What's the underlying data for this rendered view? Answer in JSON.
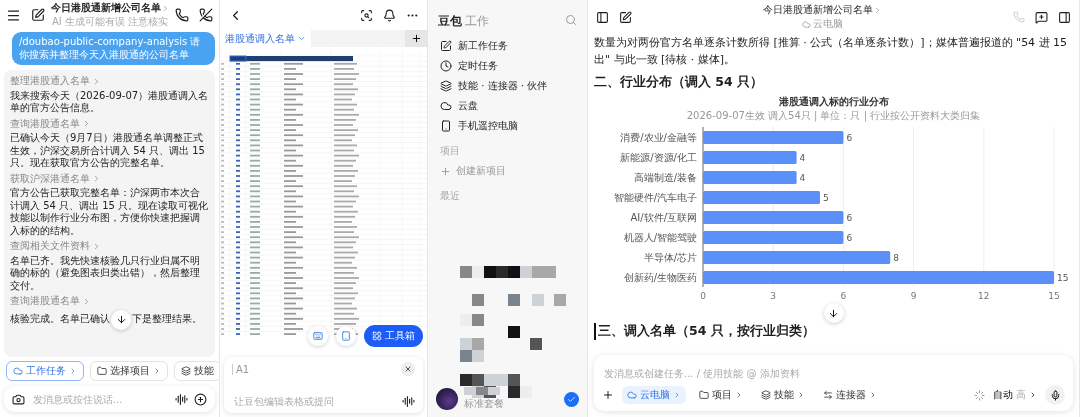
{
  "chat": {
    "title": "今日港股通新增公司名单",
    "subtitle": "AI 生成可能有误 注意核实",
    "user_message": "/doubao-public-company-analysis 请你搜索并整理今天入港股通的公司名单",
    "steps": [
      {
        "link": "整理港股通入名单",
        "text": "我来搜索今天（2026-09-07）港股通调入名单的官方公告信息。"
      },
      {
        "link": "查询港股通名单",
        "text": "已确认今天（9月7日）港股通名单调整正式生效，沪深交易所合计调入 54 只、调出 15 只。现在获取官方公告的完整名单。"
      },
      {
        "link": "获取沪深港通名单",
        "text": "官方公告已获取完整名单：沪深两市本次合计调入 54 只、调出 15 只。现在读取可视化技能以制作行业分布图，方便你快速把握调入标的的结构。"
      },
      {
        "link": "查阅相关文件资料",
        "text": "名单已齐。我先快速核验几只行业归属不明确的标的（避免图表归类出错），然后整理交付。"
      }
    ],
    "last_step": {
      "link": "查询港股通名单",
      "text_before": "核验完成。名单已确认",
      "text_after": "下是整理结果。"
    },
    "chips": [
      {
        "label": "工作任务",
        "kind": "cloud",
        "selected": true
      },
      {
        "label": "选择项目",
        "kind": "folder",
        "selected": false
      },
      {
        "label": "技能",
        "kind": "skills",
        "selected": false
      }
    ],
    "input_placeholder": "发消息或按住说话..."
  },
  "sheet": {
    "tab": "港股通调入名单",
    "cell_ref": "A1",
    "placeholder": "让豆包编辑表格或提问",
    "toolbox": "工具箱"
  },
  "sidebar": {
    "brand": "豆包",
    "brand_sub": "工作",
    "items": [
      {
        "label": "新工作任务",
        "kind": "new-task"
      },
      {
        "label": "定时任务",
        "kind": "schedule"
      },
      {
        "label": "技能 · 连接器 · 伙伴",
        "kind": "skills"
      },
      {
        "label": "云盘",
        "kind": "cloud"
      },
      {
        "label": "手机遥控电脑",
        "kind": "phone"
      }
    ],
    "projects_label": "项目",
    "create_project": "创建新项目",
    "recent_label": "最近",
    "plan": "标准套餐"
  },
  "doc": {
    "title": "今日港股通新增公司名单",
    "subtitle": "云电脑",
    "paragraph": "数量为对两份官方名单逐条计数所得 [推算 · 公式（名单逐条计数）]；媒体普遍报道的 \"54 进 15 出\" 与此一致 [待核 · 媒体]。",
    "heading_2": "二、行业分布（调入 54 只）",
    "chart_subtitle": "2026-09-07生效 调入54只 | 单位：只 | 行业按公开资料大类归集",
    "chart_data": {
      "type": "bar",
      "orientation": "horizontal",
      "title": "港股通调入标的行业分布",
      "categories": [
        "消费/农业/金融等",
        "新能源/资源/化工",
        "高端制造/装备",
        "智能硬件/汽车电子",
        "AI/软件/互联网",
        "机器人/智能驾驶",
        "半导体/芯片",
        "创新药/生物医药"
      ],
      "series": [
        {
          "color": "#5b8ff9",
          "values": [
            6,
            4,
            4,
            5,
            6,
            6,
            8,
            15
          ]
        }
      ],
      "xlim": [
        0,
        15
      ],
      "xticks": [
        0,
        3,
        6,
        9,
        12,
        15
      ],
      "grid": true,
      "data_labels": true
    },
    "heading_3": "三、调入名单（54 只，按行业归类）",
    "input_placeholder": "发消息或创建任务... / 使用技能 @ 添加资料",
    "chips": [
      {
        "label": "云电脑",
        "kind": "cloud",
        "selected": true
      },
      {
        "label": "项目",
        "kind": "folder",
        "selected": false
      },
      {
        "label": "技能",
        "kind": "skills",
        "selected": false
      },
      {
        "label": "连接器",
        "kind": "connector",
        "selected": false
      }
    ],
    "mode": "自动",
    "mode_level": "高"
  }
}
